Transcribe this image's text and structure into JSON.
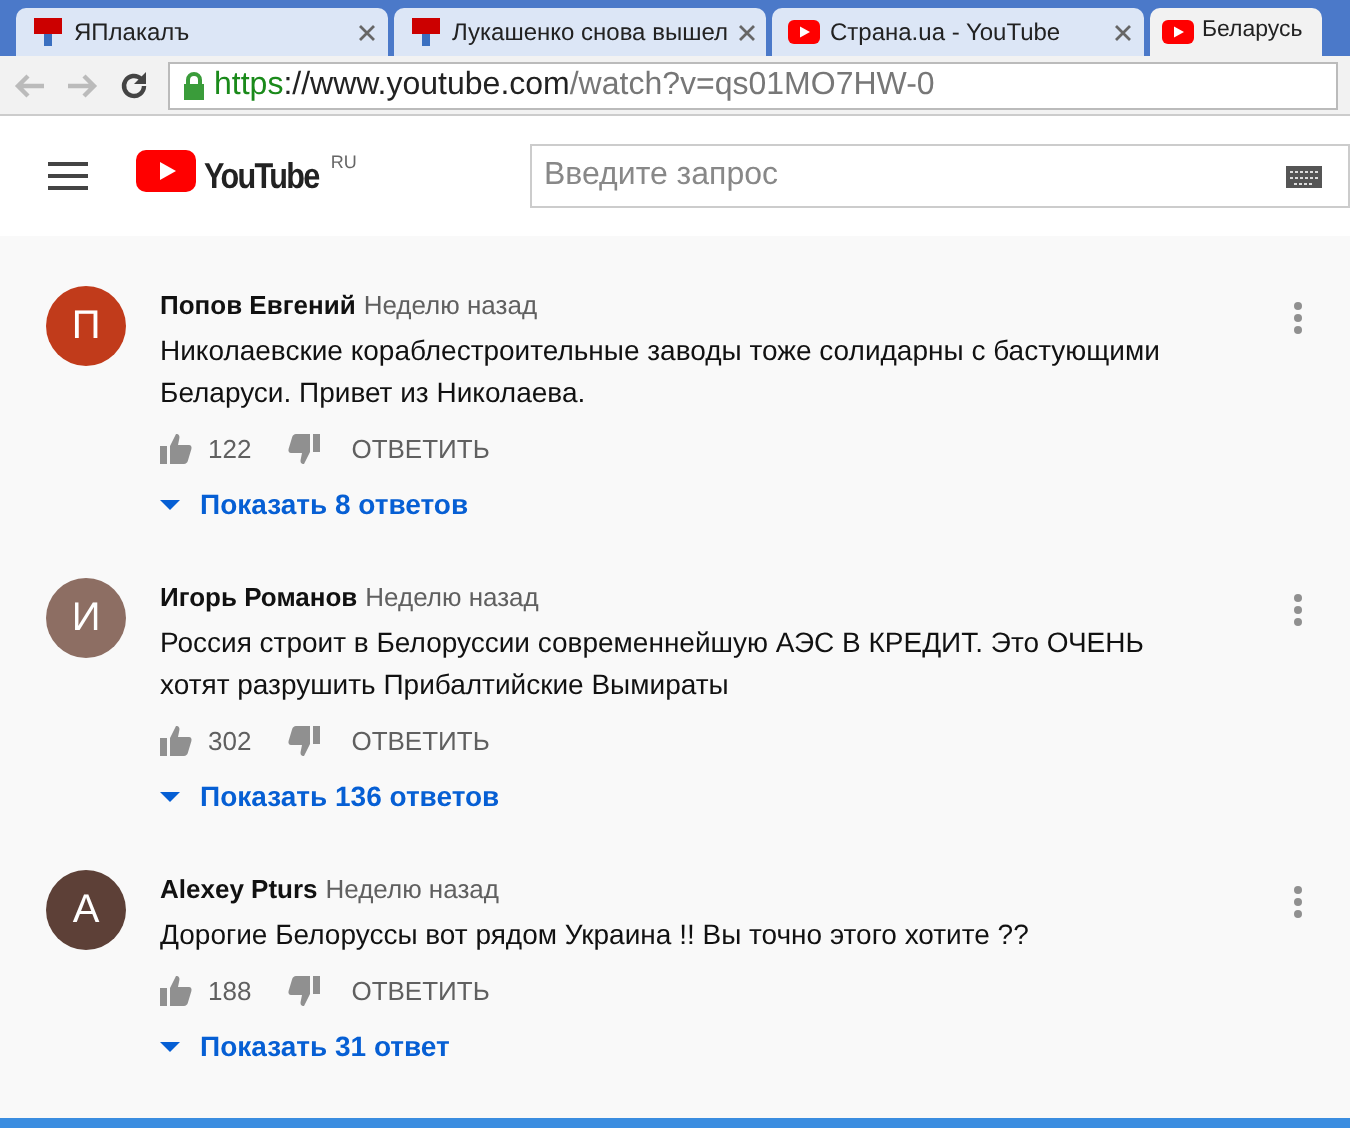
{
  "browser": {
    "tabs": [
      {
        "title": "ЯПлакалъ",
        "kind": "forum",
        "selected": false
      },
      {
        "title": "Лукашенко снова вышел",
        "kind": "forum",
        "selected": false
      },
      {
        "title": "Страна.ua - YouTube",
        "kind": "video",
        "selected": false
      },
      {
        "title": "Беларусь",
        "kind": "video",
        "selected": true
      }
    ],
    "address": {
      "scheme": "https",
      "host": "://www.youtube.com",
      "path": "/watch?v=qs01MO7HW-0"
    }
  },
  "header": {
    "logo": "YouTube",
    "region": "RU",
    "search": {
      "placeholder": "Введите запрос"
    }
  },
  "comments": [
    {
      "author": "Попов Евгений",
      "time": "Неделю назад",
      "avatar": "П",
      "color": "#c13b1b",
      "text": "Николаевские кораблестроительные заводы тоже солидарны с бастующими Беларуси. Привет из Николаева.",
      "likes": "122",
      "reply": "ОТВЕТИТЬ",
      "replies": "Показать 8 ответов"
    },
    {
      "author": "Игорь Романов",
      "time": "Неделю назад",
      "avatar": "И",
      "color": "#8d6e63",
      "text": "Россия строит в Белоруссии современнейшую АЭС В КРЕДИТ. Это ОЧЕНЬ хотят разрушить Прибалтийские Вымираты",
      "likes": "302",
      "reply": "ОТВЕТИТЬ",
      "replies": "Показать 136 ответов"
    },
    {
      "author": "Alexey Pturs",
      "time": "Неделю назад",
      "avatar": "А",
      "color": "#5d4037",
      "text": "Дорогие Белоруссы вот рядом Украина !! Вы точно этого хотите ??",
      "likes": "188",
      "reply": "ОТВЕТИТЬ",
      "replies": "Показать 31 ответ"
    }
  ]
}
